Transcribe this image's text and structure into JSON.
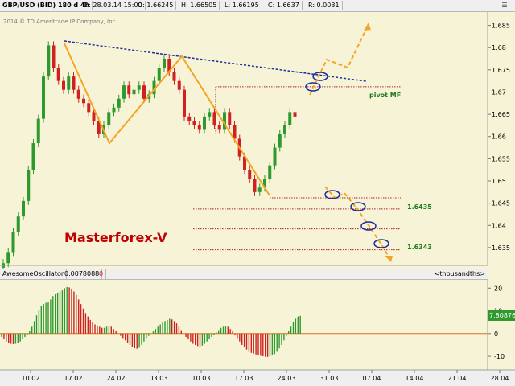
{
  "header": {
    "symbol": "GBP/USD (BID) 180 d 4h",
    "date": "D: 28.03.14 15:00",
    "open": "O: 1.66245",
    "high": "H: 1.66505",
    "low": "L: 1.66195",
    "close": "C: 1.6637",
    "range": "R: 0.0031",
    "copyright": "2014 © TD Ameritrade IP Company, Inc."
  },
  "annotations": {
    "brand": "Masterforex-V",
    "pivot": "pivot MF",
    "level1": "1.6435",
    "level2": "1.6343"
  },
  "oscillator": {
    "name": "AwesomeOscillator",
    "value": "0.0078088",
    "zero_flag": "0",
    "units": "<thousandths>",
    "current_label": "7.80876",
    "y_ticks": [
      "20",
      "10",
      "0",
      "-10"
    ]
  },
  "colors": {
    "background": "#f6f3d6",
    "bull": "#2e9a2e",
    "bear": "#d02020",
    "orange": "#f5a524",
    "trend_blue": "#1c2a9c",
    "levels": "#b02020"
  },
  "chart_data": [
    {
      "type": "line",
      "title": "GBP/USD (BID) 180 d 4h",
      "x_ticks": [
        "10.02",
        "17.02",
        "24.02",
        "03.03",
        "10.03",
        "17.03",
        "24.03",
        "31.03",
        "07.04",
        "14.04",
        "21.04",
        "28.04"
      ],
      "y_ticks": [
        "1.635",
        "1.64",
        "1.645",
        "1.65",
        "1.655",
        "1.66",
        "1.665",
        "1.67",
        "1.675",
        "1.68",
        "1.685"
      ],
      "ylim": [
        1.631,
        1.688
      ],
      "series": [
        {
          "values": [
            1.6315,
            1.634,
            1.6385,
            1.642,
            1.6455,
            1.6525,
            1.6585,
            1.664,
            1.6735,
            1.6805,
            1.6755,
            1.6725,
            1.6705,
            1.6735,
            1.6705,
            1.6685,
            1.6675,
            1.6655,
            1.6635,
            1.6605,
            1.6625,
            1.6655,
            1.6665,
            1.6685,
            1.6715,
            1.6695,
            1.6705,
            1.6715,
            1.6685,
            1.6695,
            1.6725,
            1.6755,
            1.6775,
            1.6745,
            1.6725,
            1.6705,
            1.6645,
            1.6635,
            1.6625,
            1.6615,
            1.6645,
            1.6655,
            1.6625,
            1.6615,
            1.6655,
            1.6625,
            1.6595,
            1.6555,
            1.6525,
            1.6505,
            1.6475,
            1.6485,
            1.6505,
            1.6535,
            1.6575,
            1.6605,
            1.6625,
            1.6655,
            1.6645
          ]
        }
      ],
      "pivot_level": 1.6712,
      "support_levels": [
        1.6462,
        1.6437,
        1.6392,
        1.6345
      ]
    },
    {
      "type": "bar",
      "title": "AwesomeOscillator",
      "ylim": [
        -16,
        24
      ],
      "values": [
        -1.5,
        -2.5,
        -3.5,
        -4,
        -4.5,
        -4.7,
        -4.5,
        -4,
        -3.5,
        -2.5,
        -1.5,
        -0.5,
        1,
        3,
        5.5,
        8,
        10.5,
        12,
        13,
        13.5,
        14,
        15,
        16.5,
        17.5,
        18,
        18.5,
        19,
        20,
        20.5,
        20.3,
        19.5,
        18.5,
        17,
        15,
        13,
        11,
        9,
        7.5,
        6,
        5,
        4,
        3.5,
        3,
        2.5,
        2.5,
        3,
        3.5,
        3,
        2,
        1,
        0,
        -1,
        -2,
        -3,
        -4,
        -5,
        -6,
        -6.5,
        -6.7,
        -6.2,
        -5,
        -3.5,
        -2,
        -1,
        0,
        1,
        2,
        3,
        4,
        5,
        5.5,
        6,
        6.5,
        6.2,
        5.5,
        4.5,
        3,
        1.5,
        0,
        -1.5,
        -2.5,
        -3.5,
        -4.5,
        -5,
        -5.5,
        -5.7,
        -5.3,
        -4.5,
        -3.5,
        -2.5,
        -1.5,
        -0.5,
        0.5,
        1.5,
        2.5,
        3,
        3.3,
        3,
        2,
        1,
        -0.5,
        -2,
        -3.5,
        -5,
        -6,
        -7,
        -8,
        -8.5,
        -8.8,
        -9.2,
        -9.5,
        -9.8,
        -10,
        -10.2,
        -10.3,
        -10,
        -9.5,
        -9,
        -8,
        -6.5,
        -5,
        -3,
        -1,
        1,
        3,
        5,
        6.5,
        7.5,
        7.8
      ]
    }
  ]
}
